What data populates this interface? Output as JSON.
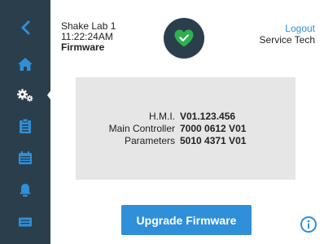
{
  "header": {
    "location": "Shake Lab 1",
    "time": "11:22:24AM",
    "section": "Firmware",
    "logout_label": "Logout",
    "user_role": "Service Tech"
  },
  "status": {
    "icon": "heart-check-icon",
    "color": "#2bb24c"
  },
  "sidebar": {
    "items": [
      {
        "icon": "back-chevron-icon"
      },
      {
        "icon": "home-icon"
      },
      {
        "icon": "settings-gears-icon",
        "active": true
      },
      {
        "icon": "clipboard-icon"
      },
      {
        "icon": "calendar-icon"
      },
      {
        "icon": "alarm-bell-icon"
      },
      {
        "icon": "message-icon"
      }
    ]
  },
  "versions": [
    {
      "label": "H.M.I.",
      "value": "V01.123.456"
    },
    {
      "label": "Main Controller",
      "value": "7000 0612 V01"
    },
    {
      "label": "Parameters",
      "value": "5010 4371 V01"
    }
  ],
  "actions": {
    "upgrade_label": "Upgrade Firmware"
  },
  "colors": {
    "sidebar_bg": "#2b3e4c",
    "icon_blue": "#2f8fd8",
    "button_blue": "#2f8fd8",
    "panel_bg": "#e6e6e6",
    "status_green": "#2bb24c"
  }
}
